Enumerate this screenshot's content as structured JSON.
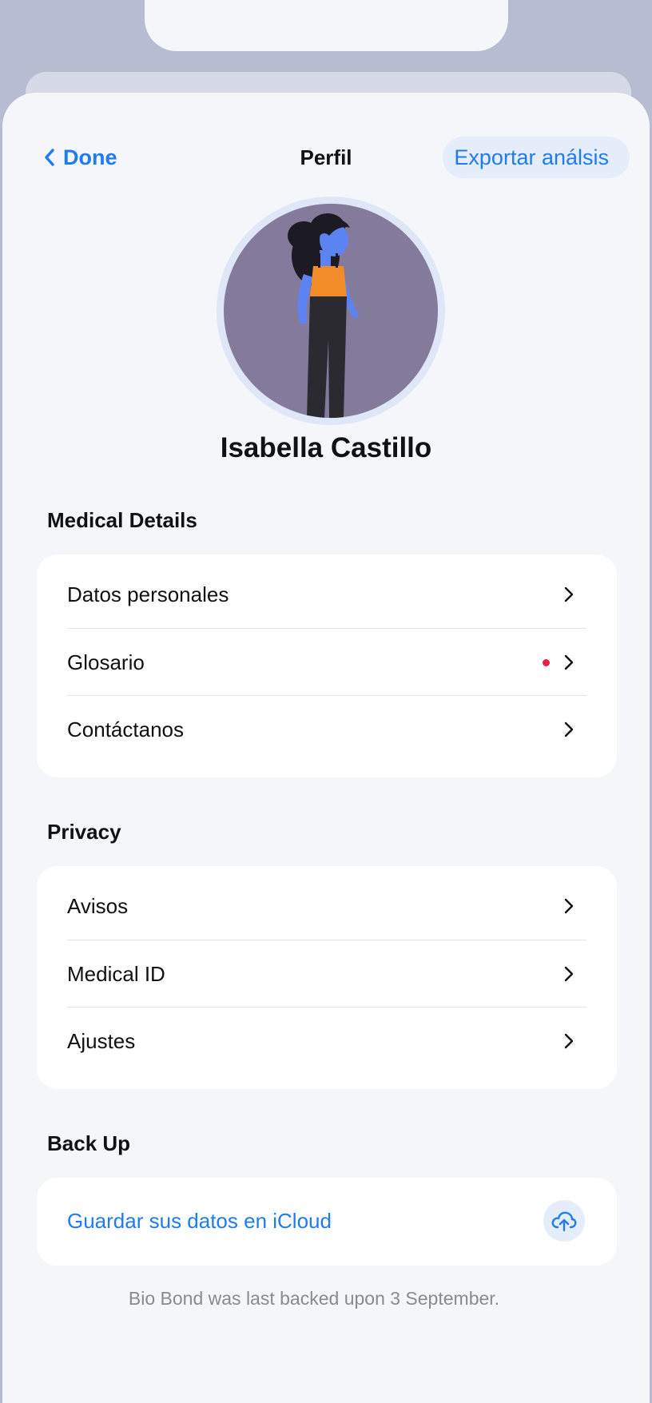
{
  "header": {
    "done_label": "Done",
    "title": "Perfil",
    "export_label": "Exportar análsis"
  },
  "profile": {
    "name": "Isabella Castillo"
  },
  "sections": {
    "medical": {
      "title": "Medical Details",
      "items": [
        {
          "label": "Datos personales",
          "badge": false
        },
        {
          "label": "Glosario",
          "badge": true
        },
        {
          "label": "Contáctanos",
          "badge": false
        }
      ]
    },
    "privacy": {
      "title": "Privacy",
      "items": [
        {
          "label": "Avisos"
        },
        {
          "label": "Medical ID"
        },
        {
          "label": "Ajustes"
        }
      ]
    },
    "backup": {
      "title": "Back Up",
      "icloud_label": "Guardar sus datos en iCloud",
      "icon": "cloud-upload-icon",
      "note": "Bio Bond was last backed upon 3 September."
    }
  },
  "colors": {
    "accent": "#1f7cf0",
    "badge": "#ee1e43",
    "background": "#f4f6fa",
    "frame": "#b7bcd3"
  }
}
